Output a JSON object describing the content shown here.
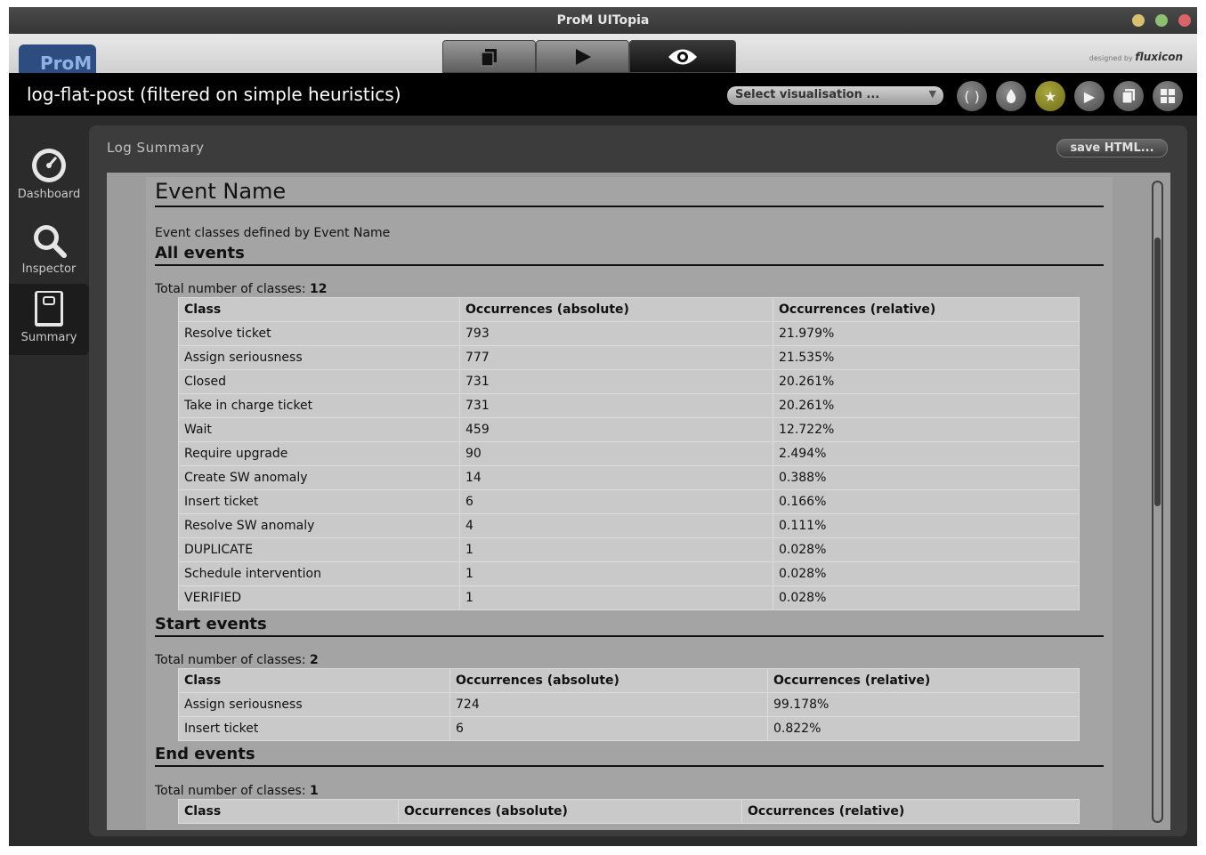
{
  "window": {
    "title": "ProM UITopia"
  },
  "top": {
    "logo": "ProM",
    "designed_by": "designed by",
    "brand": "fluxicon"
  },
  "header": {
    "title": "log-flat-post (filtered on simple heuristics)",
    "select_visualisation": "Select visualisation ..."
  },
  "nav": [
    {
      "label": "Dashboard",
      "icon": "dashboard-gauge-icon"
    },
    {
      "label": "Inspector",
      "icon": "magnifier-icon"
    },
    {
      "label": "Summary",
      "icon": "book-icon"
    }
  ],
  "panel": {
    "title": "Log Summary",
    "save_button": "save HTML..."
  },
  "doc": {
    "heading": "Event Name",
    "description": "Event classes defined by Event Name",
    "total_label": "Total number of classes:",
    "sections": [
      {
        "title": "All events",
        "total": "12",
        "columns": [
          "Class",
          "Occurrences (absolute)",
          "Occurrences (relative)"
        ],
        "rows": [
          [
            "Resolve ticket",
            "793",
            "21.979%"
          ],
          [
            "Assign seriousness",
            "777",
            "21.535%"
          ],
          [
            "Closed",
            "731",
            "20.261%"
          ],
          [
            "Take in charge ticket",
            "731",
            "20.261%"
          ],
          [
            "Wait",
            "459",
            "12.722%"
          ],
          [
            "Require upgrade",
            "90",
            "2.494%"
          ],
          [
            "Create SW anomaly",
            "14",
            "0.388%"
          ],
          [
            "Insert ticket",
            "6",
            "0.166%"
          ],
          [
            "Resolve SW anomaly",
            "4",
            "0.111%"
          ],
          [
            "DUPLICATE",
            "1",
            "0.028%"
          ],
          [
            "Schedule intervention",
            "1",
            "0.028%"
          ],
          [
            "VERIFIED",
            "1",
            "0.028%"
          ]
        ]
      },
      {
        "title": "Start events",
        "total": "2",
        "columns": [
          "Class",
          "Occurrences (absolute)",
          "Occurrences (relative)"
        ],
        "rows": [
          [
            "Assign seriousness",
            "724",
            "99.178%"
          ],
          [
            "Insert ticket",
            "6",
            "0.822%"
          ]
        ]
      },
      {
        "title": "End events",
        "total": "1",
        "columns": [
          "Class",
          "Occurrences (absolute)",
          "Occurrences (relative)"
        ],
        "rows": []
      }
    ]
  }
}
